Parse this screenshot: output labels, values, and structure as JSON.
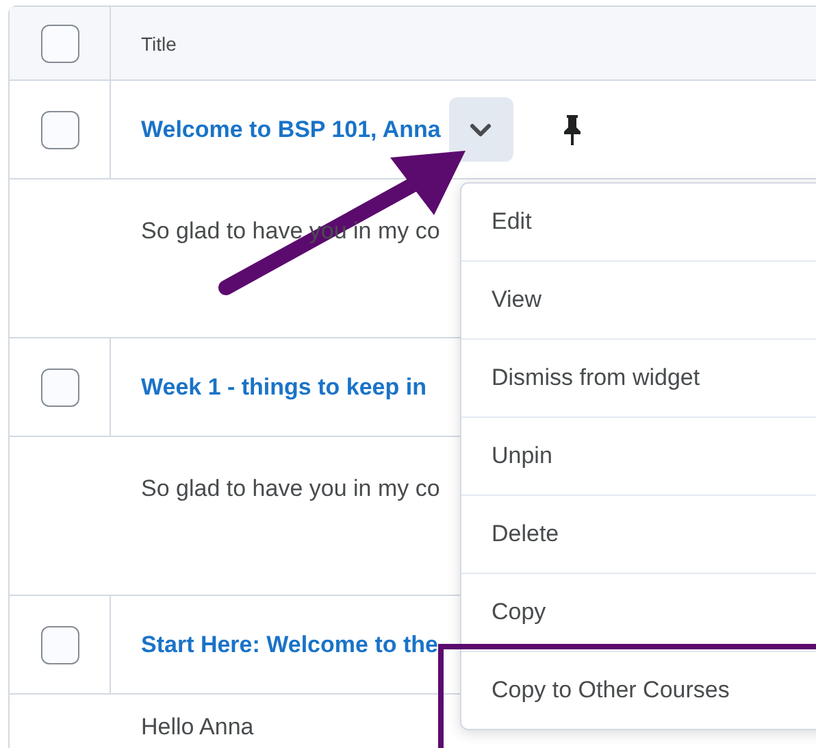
{
  "table": {
    "header_checked": false,
    "columns": [
      "Title"
    ],
    "rows": [
      {
        "title": "Welcome to BSP 101, Anna",
        "checked": false,
        "pinned": true,
        "menu_open": true,
        "body": "So glad to have you in my co"
      },
      {
        "title": "Week 1 - things to keep in",
        "checked": false,
        "body": "So glad to have you in my co"
      },
      {
        "title": "Start Here: Welcome to the",
        "checked": false,
        "body": "Hello Anna"
      }
    ]
  },
  "menu": {
    "items": [
      {
        "label": "Edit",
        "highlighted": false
      },
      {
        "label": "View",
        "highlighted": false
      },
      {
        "label": "Dismiss from widget",
        "highlighted": false
      },
      {
        "label": "Unpin",
        "highlighted": false
      },
      {
        "label": "Delete",
        "highlighted": false
      },
      {
        "label": "Copy",
        "highlighted": false
      },
      {
        "label": "Copy to Other Courses",
        "highlighted": true
      }
    ]
  }
}
